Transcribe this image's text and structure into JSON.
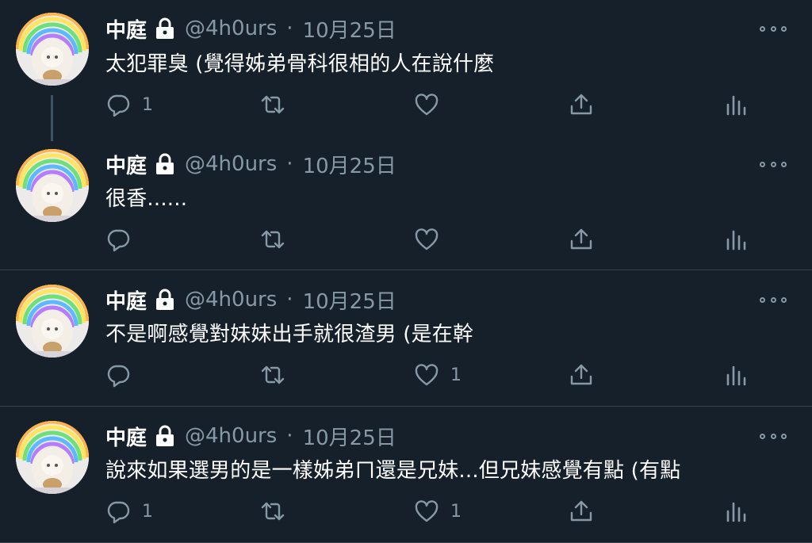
{
  "tweets": [
    {
      "name": "中庭",
      "handle": "@4h0urs",
      "dot": "·",
      "date": "10月25日",
      "text": "太犯罪臭 (覺得姊弟骨科很相的人在說什麼",
      "reply_count": "1",
      "retweet_count": "",
      "like_count": "",
      "icons": [
        "lock-icon",
        "reply-icon",
        "retweet-icon",
        "like-icon",
        "share-icon",
        "analytics-icon",
        "more-icon"
      ]
    },
    {
      "name": "中庭",
      "handle": "@4h0urs",
      "dot": "·",
      "date": "10月25日",
      "text": "很香......",
      "reply_count": "",
      "retweet_count": "",
      "like_count": ""
    },
    {
      "name": "中庭",
      "handle": "@4h0urs",
      "dot": "·",
      "date": "10月25日",
      "text": "不是啊感覺對妹妹出手就很渣男 (是在幹",
      "reply_count": "",
      "retweet_count": "",
      "like_count": "1"
    },
    {
      "name": "中庭",
      "handle": "@4h0urs",
      "dot": "·",
      "date": "10月25日",
      "text": "說來如果選男的是一樣姊弟ㄇ還是兄妹...但兄妹感覺有點 (有點",
      "reply_count": "1",
      "retweet_count": "",
      "like_count": "1"
    }
  ],
  "colors": {
    "background": "#15202b",
    "divider": "#38444d",
    "secondary_text": "#8899a6",
    "primary_text": "#ffffff"
  }
}
